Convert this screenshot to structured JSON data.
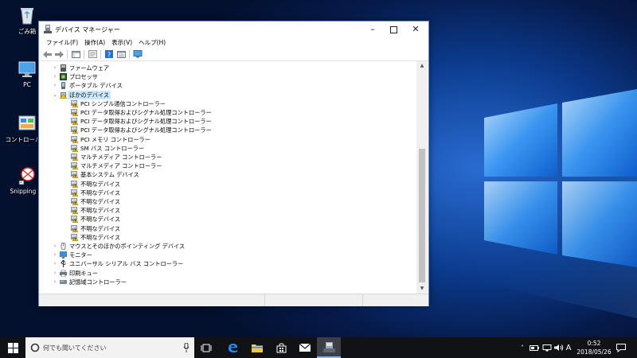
{
  "desktop": {
    "icons": [
      {
        "label": "ごみ箱"
      },
      {
        "label": "PC"
      },
      {
        "label": "コントロール パ"
      },
      {
        "label": "Snipping To"
      }
    ]
  },
  "window": {
    "title": "デバイス マネージャー",
    "menu": [
      "ファイル(F)",
      "操作(A)",
      "表示(V)",
      "ヘルプ(H)"
    ],
    "tree": [
      {
        "label": "ファームウェア",
        "level": 0,
        "expander": "›",
        "icon": "firmware-icon"
      },
      {
        "label": "プロセッサ",
        "level": 0,
        "expander": "›",
        "icon": "processor-icon"
      },
      {
        "label": "ポータブル デバイス",
        "level": 0,
        "expander": "›",
        "icon": "portable-device-icon"
      },
      {
        "label": "ほかのデバイス",
        "level": 0,
        "expander": "⌄",
        "icon": "other-devices-icon",
        "selected": true
      },
      {
        "label": "PCI シンプル通信コントローラー",
        "level": 1,
        "icon": "warning-device-icon"
      },
      {
        "label": "PCI データ取得およびシグナル処理コントローラー",
        "level": 1,
        "icon": "warning-device-icon"
      },
      {
        "label": "PCI データ取得およびシグナル処理コントローラー",
        "level": 1,
        "icon": "warning-device-icon"
      },
      {
        "label": "PCI データ取得およびシグナル処理コントローラー",
        "level": 1,
        "icon": "warning-device-icon"
      },
      {
        "label": "PCI メモリ コントローラー",
        "level": 1,
        "icon": "warning-device-icon"
      },
      {
        "label": "SM バス コントローラー",
        "level": 1,
        "icon": "warning-device-icon"
      },
      {
        "label": "マルチメディア コントローラー",
        "level": 1,
        "icon": "warning-device-icon"
      },
      {
        "label": "マルチメディア コントローラー",
        "level": 1,
        "icon": "warning-device-icon"
      },
      {
        "label": "基本システム デバイス",
        "level": 1,
        "icon": "warning-device-icon"
      },
      {
        "label": "不明なデバイス",
        "level": 1,
        "icon": "warning-device-icon"
      },
      {
        "label": "不明なデバイス",
        "level": 1,
        "icon": "warning-device-icon"
      },
      {
        "label": "不明なデバイス",
        "level": 1,
        "icon": "warning-device-icon"
      },
      {
        "label": "不明なデバイス",
        "level": 1,
        "icon": "warning-device-icon"
      },
      {
        "label": "不明なデバイス",
        "level": 1,
        "icon": "warning-device-icon"
      },
      {
        "label": "不明なデバイス",
        "level": 1,
        "icon": "warning-device-icon"
      },
      {
        "label": "不明なデバイス",
        "level": 1,
        "icon": "warning-device-icon"
      },
      {
        "label": "マウスとそのほかのポインティング デバイス",
        "level": 0,
        "expander": "›",
        "icon": "mouse-icon"
      },
      {
        "label": "モニター",
        "level": 0,
        "expander": "›",
        "icon": "monitor-icon"
      },
      {
        "label": "ユニバーサル シリアル バス コントローラー",
        "level": 0,
        "expander": "›",
        "icon": "usb-icon"
      },
      {
        "label": "印刷キュー",
        "level": 0,
        "expander": "›",
        "icon": "printer-icon"
      },
      {
        "label": "記憶域コントローラー",
        "level": 0,
        "expander": "›",
        "icon": "storage-icon"
      }
    ]
  },
  "taskbar": {
    "search_placeholder": "何でも聞いてください",
    "ime_indicator": "A",
    "time": "0:52",
    "date": "2018/05/26"
  },
  "colors": {
    "accent": "#0078d7",
    "selection": "#cce8ff",
    "warning": "#f2c200",
    "taskbar": "#101216"
  }
}
